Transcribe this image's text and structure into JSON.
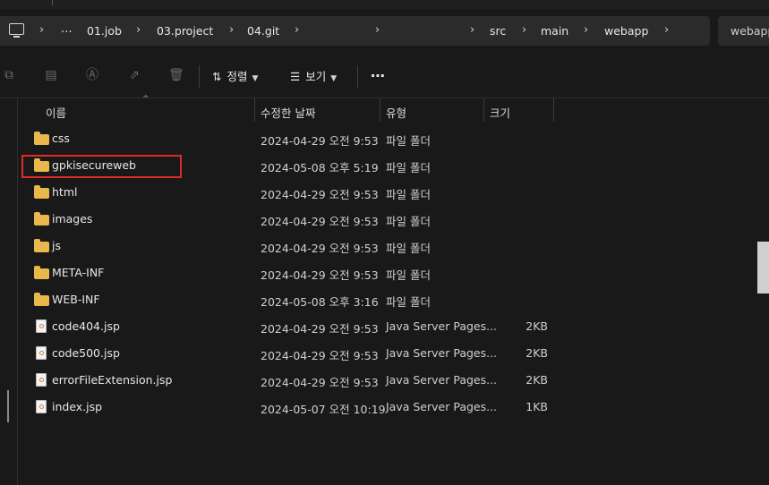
{
  "address": {
    "more_glyph": "⋯",
    "chevron": "›",
    "crumbs": [
      "01.job",
      "03.project",
      "04.git",
      "src",
      "main",
      "webapp"
    ],
    "tab_label": "webapp"
  },
  "toolbar": {
    "sort_label": "정렬",
    "view_label": "보기",
    "more_label": "⋯"
  },
  "columns": {
    "name": "이름",
    "modified": "수정한 날짜",
    "type": "유형",
    "size": "크기"
  },
  "files": [
    {
      "name": "css",
      "modified": "2024-04-29 오전 9:53",
      "type": "파일 폴더",
      "size": "",
      "kind": "folder"
    },
    {
      "name": "gpkisecureweb",
      "modified": "2024-05-08 오후 5:19",
      "type": "파일 폴더",
      "size": "",
      "kind": "folder"
    },
    {
      "name": "html",
      "modified": "2024-04-29 오전 9:53",
      "type": "파일 폴더",
      "size": "",
      "kind": "folder"
    },
    {
      "name": "images",
      "modified": "2024-04-29 오전 9:53",
      "type": "파일 폴더",
      "size": "",
      "kind": "folder"
    },
    {
      "name": "js",
      "modified": "2024-04-29 오전 9:53",
      "type": "파일 폴더",
      "size": "",
      "kind": "folder"
    },
    {
      "name": "META-INF",
      "modified": "2024-04-29 오전 9:53",
      "type": "파일 폴더",
      "size": "",
      "kind": "folder"
    },
    {
      "name": "WEB-INF",
      "modified": "2024-05-08 오후 3:16",
      "type": "파일 폴더",
      "size": "",
      "kind": "folder"
    },
    {
      "name": "code404.jsp",
      "modified": "2024-04-29 오전 9:53",
      "type": "Java Server Pages...",
      "size": "2KB",
      "kind": "file"
    },
    {
      "name": "code500.jsp",
      "modified": "2024-04-29 오전 9:53",
      "type": "Java Server Pages...",
      "size": "2KB",
      "kind": "file"
    },
    {
      "name": "errorFileExtension.jsp",
      "modified": "2024-04-29 오전 9:53",
      "type": "Java Server Pages...",
      "size": "2KB",
      "kind": "file"
    },
    {
      "name": "index.jsp",
      "modified": "2024-05-07 오전 10:19",
      "type": "Java Server Pages...",
      "size": "1KB",
      "kind": "file"
    }
  ],
  "highlight_color": "#e02a2a",
  "folder_color": "#e8b84a"
}
